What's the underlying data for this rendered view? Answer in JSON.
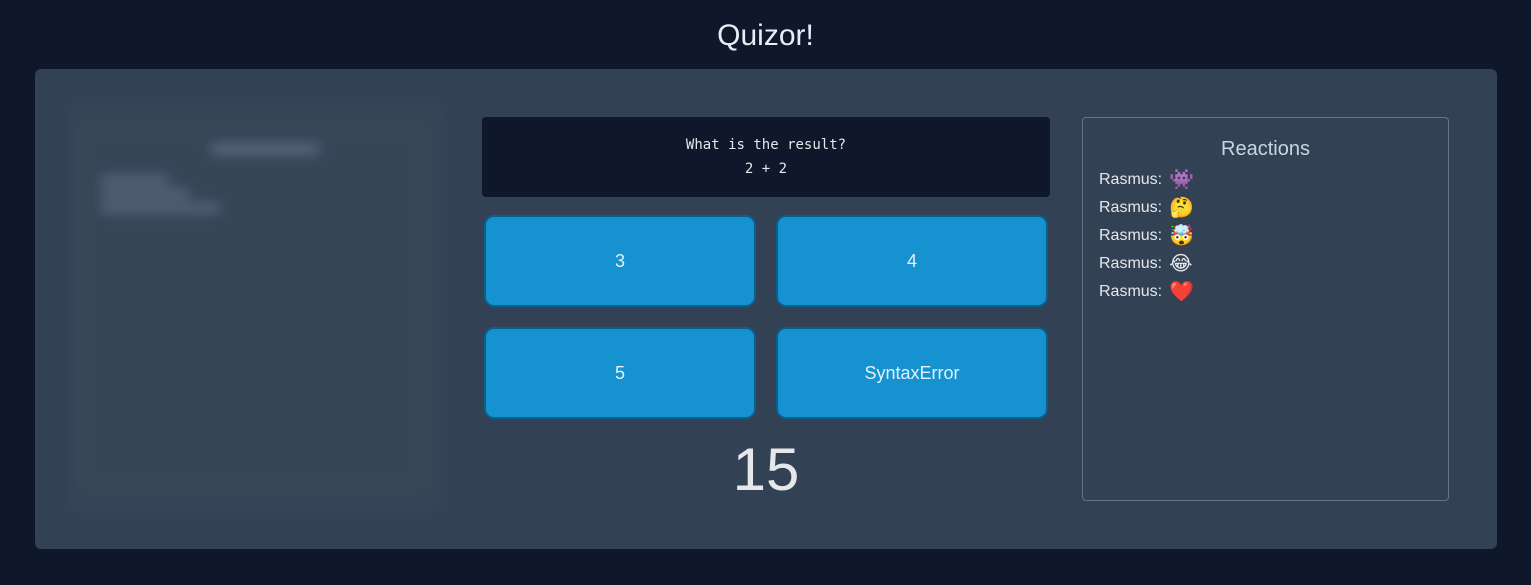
{
  "app": {
    "title": "Quizor!"
  },
  "question": {
    "line1": "What is the result?",
    "line2": "2 + 2"
  },
  "answers": [
    {
      "label": "3"
    },
    {
      "label": "4"
    },
    {
      "label": "5"
    },
    {
      "label": "SyntaxError"
    }
  ],
  "timer": {
    "value": "15"
  },
  "reactions": {
    "title": "Reactions",
    "items": [
      {
        "user": "Rasmus:",
        "emoji": "👾"
      },
      {
        "user": "Rasmus:",
        "emoji": "🤔"
      },
      {
        "user": "Rasmus:",
        "emoji": "🤯"
      },
      {
        "user": "Rasmus:",
        "emoji": "😂"
      },
      {
        "user": "Rasmus:",
        "emoji": "❤️"
      }
    ]
  },
  "colors": {
    "page_background": "#0f172a",
    "panel_background": "#334155",
    "answer_button": "#1592cf",
    "question_background": "#0f172a"
  }
}
